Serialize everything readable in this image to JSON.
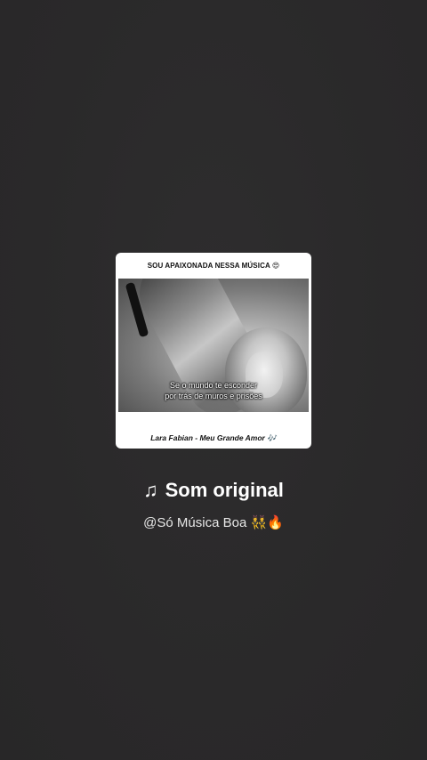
{
  "card": {
    "header_text": "SOU APAIXONADA NESSA MÚSICA 😍",
    "subtitle_line1": "Se o mundo te esconder",
    "subtitle_line2": "por trás de muros e prisões",
    "footer_text": "Lara Fabian - Meu Grande Amor 🎶"
  },
  "sound": {
    "note_icon": "♫",
    "title": "Som original",
    "author": "@Só Música Boa 👯🔥"
  },
  "colors": {
    "background": "#2b2a2b",
    "text_primary": "#ffffff",
    "text_secondary": "#e6e6e6"
  }
}
